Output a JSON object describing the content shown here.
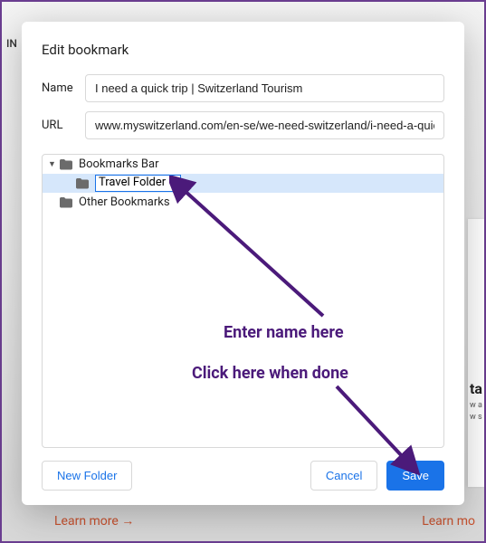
{
  "backdrop": {
    "top_left_text": "IN",
    "learn_more_left": "Learn more  →",
    "learn_more_right": "Learn mo",
    "right_card_title": "ta",
    "right_card_lines": "w\na\nw\ns"
  },
  "modal": {
    "title": "Edit bookmark",
    "name_label": "Name",
    "name_value": "I need a quick trip | Switzerland Tourism",
    "url_label": "URL",
    "url_value": "www.myswitzerland.com/en-se/we-need-switzerland/i-need-a-quick-trip/",
    "tree": {
      "bookmarks_bar": "Bookmarks Bar",
      "editing_folder_name": "Travel Folder",
      "other_bookmarks": "Other Bookmarks"
    },
    "new_folder_label": "New Folder",
    "cancel_label": "Cancel",
    "save_label": "Save"
  },
  "annotations": {
    "enter_name": "Enter name here",
    "click_done": "Click here when done"
  },
  "colors": {
    "accent": "#1a73e8",
    "annotation": "#4b1a7a",
    "link_orange": "#c8522f"
  }
}
